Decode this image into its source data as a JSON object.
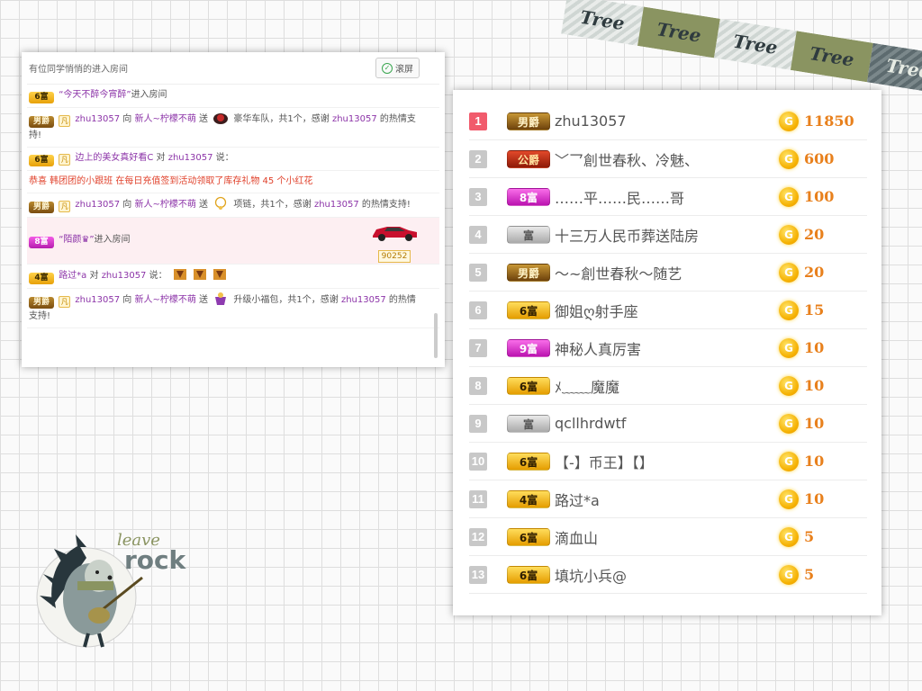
{
  "tape": {
    "labels": [
      "Tree",
      "Tree",
      "Tree",
      "Tree",
      "Tree"
    ]
  },
  "chat": {
    "header": "有位同学悄悄的进入房间",
    "scroll_button_label": "滚屏",
    "messages": [
      {
        "badge": "6富",
        "pre": "",
        "user": "“今天不醉今宵醉”",
        "text": "进入房间"
      },
      {
        "badge": "男爵",
        "icon": "凡",
        "user": "zhu13057",
        "p1": " 向 ",
        "target": "新人~柠檬不萌",
        "p2": " 送 ",
        "gift_text": " 豪华车队，共1个，感谢 ",
        "user2": "zhu13057",
        "end": " 的热情支持!"
      },
      {
        "badge": "6富",
        "icon": "凡",
        "user": "边上的美女真好看C",
        "p1": " 对 ",
        "target": "zhu13057",
        "p2": " 说："
      },
      {
        "notice": "恭喜 韩团团的小跟班 在每日充值签到活动领取了库存礼物 45 个小红花"
      },
      {
        "badge": "男爵",
        "icon": "凡",
        "user": "zhu13057",
        "p1": " 向 ",
        "target": "新人~柠檬不萌",
        "p2": " 送 ",
        "gift_text": " 项链，共1个，感谢 ",
        "user2": "zhu13057",
        "end": " 的热情支持!"
      },
      {
        "badge": "8富",
        "user": "“陌颜♛”",
        "text": "进入房间",
        "car_number": "90252"
      },
      {
        "badge": "4富",
        "user": "路过*a",
        "p1": " 对 ",
        "target": "zhu13057",
        "p2": " 说："
      },
      {
        "badge": "男爵",
        "icon": "凡",
        "user": "zhu13057",
        "p1": " 向 ",
        "target": "新人~柠檬不萌",
        "p2": " 送 ",
        "gift_text": " 升级小福包，共1个，感谢 ",
        "user2": "zhu13057",
        "end": " 的热情支持!"
      }
    ]
  },
  "ranking": {
    "rows": [
      {
        "rank": "1",
        "badge": "男爵",
        "name": "zhu13057",
        "score": "11850"
      },
      {
        "rank": "2",
        "badge": "公爵",
        "name": "﹀乛創世春秋、冷魅、",
        "score": "600"
      },
      {
        "rank": "3",
        "badge": "8富",
        "name": "……平……民……哥",
        "score": "100"
      },
      {
        "rank": "4",
        "badge": "富",
        "name": "十三万人民币葬送陆房",
        "score": "20"
      },
      {
        "rank": "5",
        "badge": "男爵",
        "name": "～~創世春秋～随艺",
        "score": "20"
      },
      {
        "rank": "6",
        "badge": "6富",
        "name": "御姐ღ射手座",
        "score": "15"
      },
      {
        "rank": "7",
        "badge": "9富",
        "name": "神秘人真厉害",
        "score": "10"
      },
      {
        "rank": "8",
        "badge": "6富",
        "name": "ﾒ﹏﹏魔魔",
        "score": "10"
      },
      {
        "rank": "9",
        "badge": "富",
        "name": "qcllhrdwtf",
        "score": "10"
      },
      {
        "rank": "10",
        "badge": "6富",
        "name": "【-】币王】【】",
        "score": "10"
      },
      {
        "rank": "11",
        "badge": "4富",
        "name": "路过*a",
        "score": "10"
      },
      {
        "rank": "12",
        "badge": "6富",
        "name": "滴血山",
        "score": "5"
      },
      {
        "rank": "13",
        "badge": "6富",
        "name": "填坑小兵@",
        "score": "5"
      }
    ],
    "coin_glyph": "G"
  },
  "sticker": {
    "text_top": "leave",
    "text_main": "rock"
  }
}
